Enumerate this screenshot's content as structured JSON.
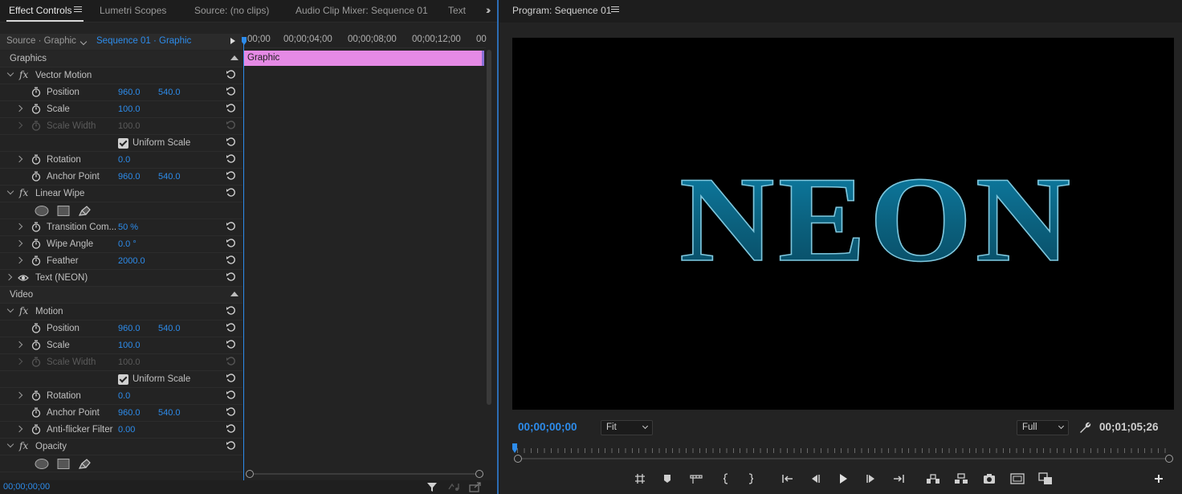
{
  "left_tabs": {
    "effect_controls": "Effect Controls",
    "lumetri_scopes": "Lumetri Scopes",
    "source": "Source: (no clips)",
    "audio_clip_mixer": "Audio Clip Mixer: Sequence 01",
    "text": "Text"
  },
  "source_header": {
    "master": "Source · Graphic",
    "sequence": "Sequence 01 · Graphic"
  },
  "ruler": {
    "t0": "00;00",
    "t1": "00;00;04;00",
    "t2": "00;00;08;00",
    "t3": "00;00;12;00",
    "t4": "00"
  },
  "clip_label": "Graphic",
  "sections": {
    "graphics": "Graphics",
    "video": "Video"
  },
  "vector_motion": {
    "name": "Vector Motion",
    "position_label": "Position",
    "position_x": "960.0",
    "position_y": "540.0",
    "scale_label": "Scale",
    "scale": "100.0",
    "scale_width_label": "Scale Width",
    "scale_width": "100.0",
    "uniform_scale_label": "Uniform Scale",
    "rotation_label": "Rotation",
    "rotation": "0.0",
    "anchor_label": "Anchor Point",
    "anchor_x": "960.0",
    "anchor_y": "540.0"
  },
  "linear_wipe": {
    "name": "Linear Wipe",
    "transition_label": "Transition Com...",
    "transition": "50 %",
    "wipe_angle_label": "Wipe Angle",
    "wipe_angle": "0.0 °",
    "feather_label": "Feather",
    "feather": "2000.0"
  },
  "text_layer": {
    "name": "Text (NEON)"
  },
  "motion": {
    "name": "Motion",
    "position_label": "Position",
    "position_x": "960.0",
    "position_y": "540.0",
    "scale_label": "Scale",
    "scale": "100.0",
    "scale_width_label": "Scale Width",
    "scale_width": "100.0",
    "uniform_scale_label": "Uniform Scale",
    "rotation_label": "Rotation",
    "rotation": "0.0",
    "anchor_label": "Anchor Point",
    "anchor_x": "960.0",
    "anchor_y": "540.0",
    "antiflicker_label": "Anti-flicker Filter",
    "antiflicker": "0.00"
  },
  "opacity": {
    "name": "Opacity"
  },
  "ec_timecode": "00;00;00;00",
  "program": {
    "title": "Program: Sequence 01",
    "video_text": "NEON",
    "timecode": "00;00;00;00",
    "fit": "Fit",
    "resolution": "Full",
    "duration": "00;01;05;26"
  },
  "colors": {
    "accent": "#2d8ceb",
    "clip": "#e58ae5",
    "neon_text": "#0d7fa7"
  }
}
